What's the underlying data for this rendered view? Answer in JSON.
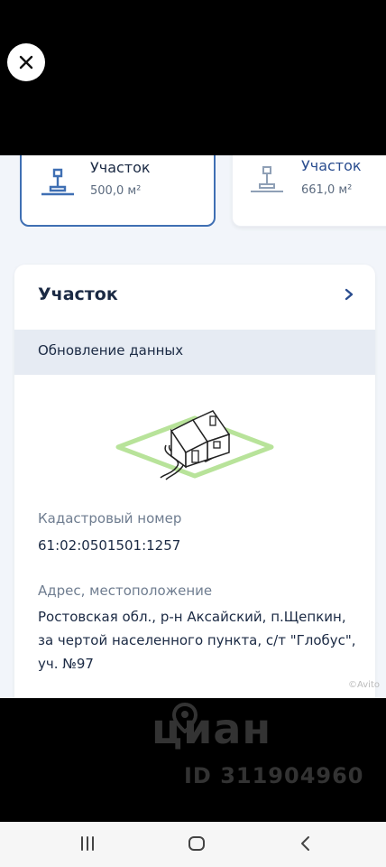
{
  "plots": [
    {
      "title": "Участок",
      "area": "500,0 м²",
      "selected": true
    },
    {
      "title": "Участок",
      "area": "661,0 м²",
      "selected": false
    }
  ],
  "section": {
    "title": "Участок",
    "update_label": "Обновление данных"
  },
  "cadastral": {
    "label": "Кадастровый номер",
    "value": "61:02:0501501:1257"
  },
  "address": {
    "label": "Адрес, местоположение",
    "line1": "Ростовская обл., р-н Аксайский, п.Щепкин,",
    "line2": "за чертой населенного пункта, с/т \"Глобус\",",
    "line3": "уч. №97"
  },
  "watermark": {
    "brand": "циан",
    "id": "ID 311904960",
    "small": "©Avito"
  },
  "colors": {
    "accent": "#3f6fb3",
    "title": "#1b2a44",
    "muted": "#6f7d90",
    "land_green": "#b8e39a"
  },
  "icons": [
    "close-icon",
    "plot-icon",
    "chevron-right-icon",
    "house-plot-illustration",
    "location-pin-icon",
    "recents-icon",
    "home-icon",
    "back-icon"
  ]
}
